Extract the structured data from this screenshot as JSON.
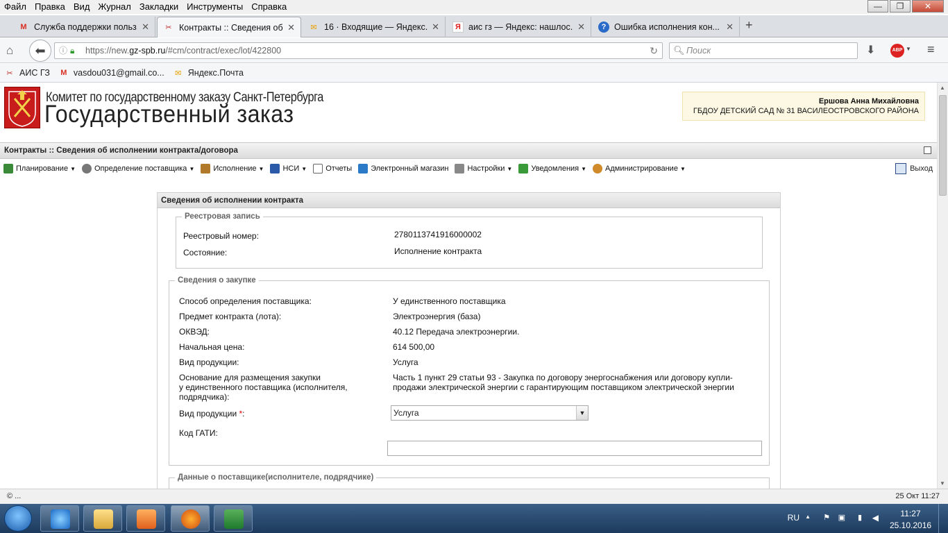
{
  "menu": [
    "Файл",
    "Правка",
    "Вид",
    "Журнал",
    "Закладки",
    "Инструменты",
    "Справка"
  ],
  "window_controls": {
    "minimize": "—",
    "maximize": "❐",
    "close": "✕"
  },
  "tabs": [
    {
      "label": "Служба поддержки польз...",
      "icon": "gmail-icon",
      "active": false
    },
    {
      "label": "Контракты :: Сведения об ...",
      "icon": "tools-icon",
      "active": true
    },
    {
      "label": "16 · Входящие — Яндекс....",
      "icon": "yandex-mail-icon",
      "active": false
    },
    {
      "label": "аис гз — Яндекс: нашлос...",
      "icon": "yandex-icon",
      "active": false
    },
    {
      "label": "Ошибка исполнения кон...",
      "icon": "help-icon",
      "active": false
    }
  ],
  "new_tab": "+",
  "address": {
    "prefix": "https://new.",
    "domain": "gz-spb.ru",
    "rest": "/#cm/contract/exec/lot/422800"
  },
  "search_placeholder": "Поиск",
  "bookmarks": [
    {
      "label": "АИС ГЗ",
      "icon": "tools-icon"
    },
    {
      "label": "vasdou031@gmail.co...",
      "icon": "gmail-icon"
    },
    {
      "label": "Яндекс.Почта",
      "icon": "yandex-mail-icon"
    }
  ],
  "header": {
    "org_line1": "Комитет по государственному заказу Санкт-Петербурга",
    "org_line2": "Государственный заказ",
    "user_name": "Ершова Анна Михайловна",
    "user_org": "ГБДОУ ДЕТСКИЙ САД № 31 ВАСИЛЕОСТРОВСКОГО РАЙОНА"
  },
  "breadcrumb": "Контракты :: Сведения об исполнении контракта/договора",
  "toolbar": [
    {
      "label": "Планирование",
      "dropdown": true,
      "color": "#3a8a3a"
    },
    {
      "label": "Определение поставщика",
      "dropdown": true,
      "color": "#555555"
    },
    {
      "label": "Исполнение",
      "dropdown": true,
      "color": "#b07a2a"
    },
    {
      "label": "НСИ",
      "dropdown": true,
      "color": "#2a5aa8"
    },
    {
      "label": "Отчеты",
      "dropdown": false,
      "color": "#666666"
    },
    {
      "label": "Электронный магазин",
      "dropdown": false,
      "color": "#2a7ac8"
    },
    {
      "label": "Настройки",
      "dropdown": true,
      "color": "#555555"
    },
    {
      "label": "Уведомления",
      "dropdown": true,
      "color": "#3a9a3a"
    },
    {
      "label": "Администрирование",
      "dropdown": true,
      "color": "#d08a2a"
    }
  ],
  "exit_label": "Выход",
  "panel": {
    "title": "Сведения об исполнении контракта",
    "registry": {
      "legend": "Реестровая запись",
      "number_label": "Реестровый номер:",
      "number_value": "2780113741916000002",
      "state_label": "Состояние:",
      "state_value": "Исполнение контракта"
    },
    "purchase": {
      "legend": "Сведения о закупке",
      "method_label": "Способ определения поставщика:",
      "method_value": "У единственного поставщика",
      "subject_label": "Предмет контракта (лота):",
      "subject_value": "Электроэнергия (база)",
      "okved_label": "ОКВЭД:",
      "okved_value": "40.12 Передача электроэнергии.",
      "price_label": "Начальная цена:",
      "price_value": "614 500,00",
      "product_label": "Вид продукции:",
      "product_value": "Услуга",
      "basis_label_1": "Основание для размещения закупки",
      "basis_label_2": "у единственного поставщика (исполнителя,",
      "basis_label_3": "подрядчика):",
      "basis_value_1": "Часть 1 пункт 29 статьи 93 - Закупка по договору энергоснабжения или договору купли-",
      "basis_value_2": "продажи электрической энергии с гарантирующим поставщиком электрической энергии",
      "product_select_label": "Вид продукции",
      "required_mark": "*",
      "product_select_colon": ":",
      "product_select_value": "Услуга",
      "gati_label": "Код ГАТИ:",
      "gati_value": ""
    },
    "supplier_legend": "Данные о поставщике(исполнителе, подрядчике)"
  },
  "statusbar": {
    "left": "© ...",
    "right": "25 Окт 11:27"
  },
  "tray": {
    "lang": "RU",
    "time": "11:27",
    "date": "25.10.2016"
  },
  "taskbar_items": [
    "ie-icon",
    "explorer-icon",
    "media-player-icon",
    "firefox-icon",
    "excel-icon"
  ]
}
